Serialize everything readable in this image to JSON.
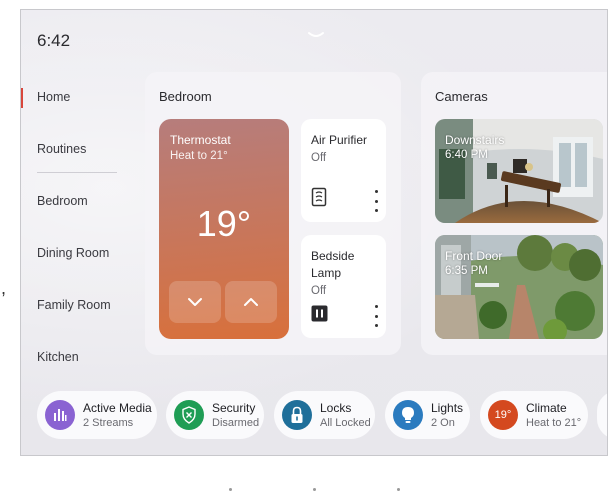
{
  "status": {
    "time": "6:42"
  },
  "nav": {
    "items": [
      "Home",
      "Routines",
      "Bedroom",
      "Dining Room",
      "Family Room",
      "Kitchen"
    ]
  },
  "bedroom": {
    "title": "Bedroom",
    "thermostat": {
      "name": "Thermostat",
      "status": "Heat to 21°",
      "temperature": "19°"
    },
    "air_purifier": {
      "name": "Air Purifier",
      "status": "Off"
    },
    "lamp": {
      "name_line1": "Bedside",
      "name_line2": "Lamp",
      "status": "Off"
    }
  },
  "cameras": {
    "title": "Cameras",
    "items": [
      {
        "name": "Downstairs",
        "time": "6:40 PM"
      },
      {
        "name": "Front Door",
        "time": "6:35 PM"
      }
    ]
  },
  "shortcuts": [
    {
      "title": "Active Media",
      "subtitle": "2 Streams",
      "icon": "audio-bars-icon",
      "color": "#8a63d2"
    },
    {
      "title": "Security",
      "subtitle": "Disarmed",
      "icon": "shield-icon",
      "color": "#1f9d55"
    },
    {
      "title": "Locks",
      "subtitle": "All Locked",
      "icon": "lock-icon",
      "color": "#1f6f9a"
    },
    {
      "title": "Lights",
      "subtitle": "2 On",
      "icon": "bulb-icon",
      "color": "#2b7bbf"
    },
    {
      "title": "Climate",
      "subtitle": "Heat to 21°",
      "icon_text": "19°",
      "icon": "climate-icon",
      "color": "#d4491f"
    }
  ],
  "colors": {
    "accent": "#d8463b",
    "thermostat": "#c97659"
  }
}
